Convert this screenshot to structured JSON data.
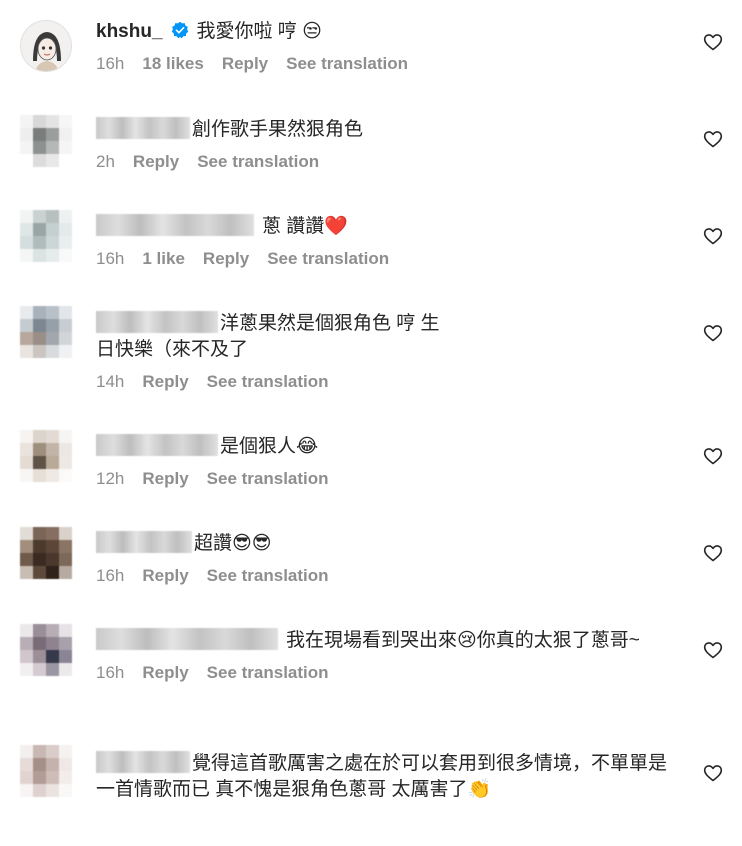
{
  "comments": [
    {
      "username": "khshu_",
      "verified": true,
      "text": "我愛你啦 哼 😒",
      "time": "16h",
      "likes": "18 likes",
      "reply": "Reply",
      "translate": "See translation"
    },
    {
      "text": "創作歌手果然狠角色",
      "time": "2h",
      "reply": "Reply",
      "translate": "See translation"
    },
    {
      "text": "蔥 讚讚❤️",
      "time": "16h",
      "likes": "1 like",
      "reply": "Reply",
      "translate": "See translation"
    },
    {
      "text": "洋蔥果然是個狠角色 哼 生日快樂（來不及了",
      "time": "14h",
      "reply": "Reply",
      "translate": "See translation"
    },
    {
      "text": "是個狠人😂",
      "time": "12h",
      "reply": "Reply",
      "translate": "See translation"
    },
    {
      "text": "超讚😎😎",
      "time": "16h",
      "reply": "Reply",
      "translate": "See translation"
    },
    {
      "text": "我在現場看到哭出來😢你真的太狠了蔥哥~",
      "time": "16h",
      "reply": "Reply",
      "translate": "See translation"
    },
    {
      "text": "覺得這首歌厲害之處在於可以套用到很多情境，不單單是一首情歌而已 真不愧是狠角色蔥哥 太厲害了👏"
    }
  ],
  "colors": {
    "text": "#262626",
    "meta": "#8e8e8e",
    "verified": "#0095f6"
  },
  "icons": {
    "like": "heart-outline-icon",
    "verified": "verified-badge-icon"
  }
}
